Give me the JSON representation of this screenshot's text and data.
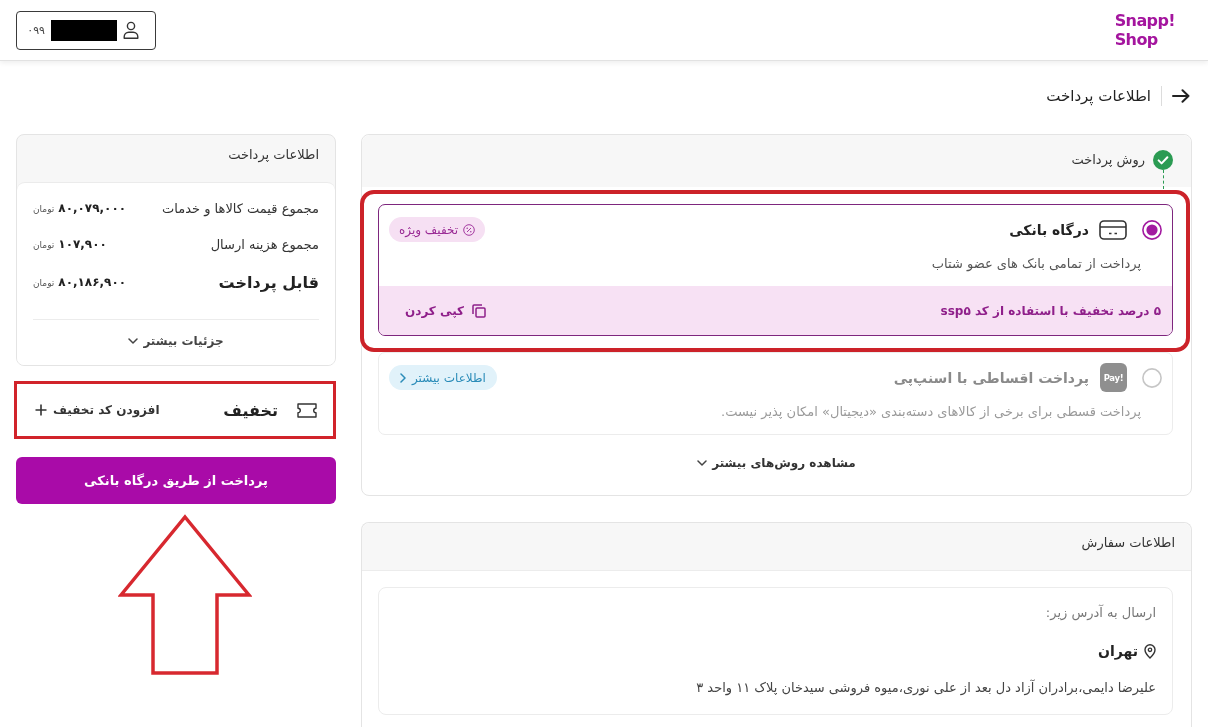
{
  "header": {
    "logo": {
      "line_1": "Snapp!",
      "line_2": "Shop"
    },
    "account": {
      "phone": "۰۹۹",
      "redacted": true
    }
  },
  "page_title": "اطلاعات پرداخت",
  "summary": {
    "title": "اطلاعات پرداخت",
    "rows": [
      {
        "kind": "line",
        "label": "مجموع قیمت کالاها و خدمات",
        "amount": "۸۰,۰۷۹,۰۰۰",
        "currency": "تومان"
      },
      {
        "kind": "line",
        "label": "مجموع هزینه ارسال",
        "amount": "۱۰۷,۹۰۰",
        "currency": "تومان"
      },
      {
        "kind": "total",
        "label": "قابل پرداخت",
        "amount": "۸۰,۱۸۶,۹۰۰",
        "currency": "تومان"
      }
    ],
    "more_details": "جزئیات بیشتر"
  },
  "discount": {
    "title": "تخفیف",
    "action": "افزودن کد تخفیف",
    "highlighted": true
  },
  "pay_button": {
    "label": "پرداخت از طریق درگاه بانکی",
    "pointer_arrow": true
  },
  "payment": {
    "title": "روش پرداخت",
    "step_completed": true,
    "methods": [
      {
        "kind": "bank_gateway",
        "name": "درگاه بانکی",
        "selected": true,
        "disabled": false,
        "highlighted": true,
        "badge": {
          "kind": "offer",
          "label": "تخفیف ویژه"
        },
        "description": "پرداخت از تمامی بانک های عضو شتاب",
        "promo": {
          "text": "۵ درصد تخفیف با استفاده از کد ssp۵",
          "action": "کپی کردن"
        }
      },
      {
        "kind": "installment",
        "name": "پرداخت اقساطی با اسنپ‌پی",
        "logo_text": "Pay!",
        "selected": false,
        "disabled": true,
        "highlighted": false,
        "badge": {
          "kind": "link",
          "label": "اطلاعات بیشتر"
        },
        "description": "پرداخت قسطی برای برخی از کالاهای دسته‌بندی «دیجیتال» امکان پذیر نیست."
      }
    ],
    "more_methods": "مشاهده روش‌های بیشتر"
  },
  "order": {
    "title": "اطلاعات سفارش",
    "ship_label": "ارسال به آدرس زیر:",
    "city": "تهران",
    "address": "علیرضا دایمی،برادران آزاد دل بعد از علی نوری،میوه فروشی سیدخان پلاک ۱۱ واحد ۳"
  }
}
